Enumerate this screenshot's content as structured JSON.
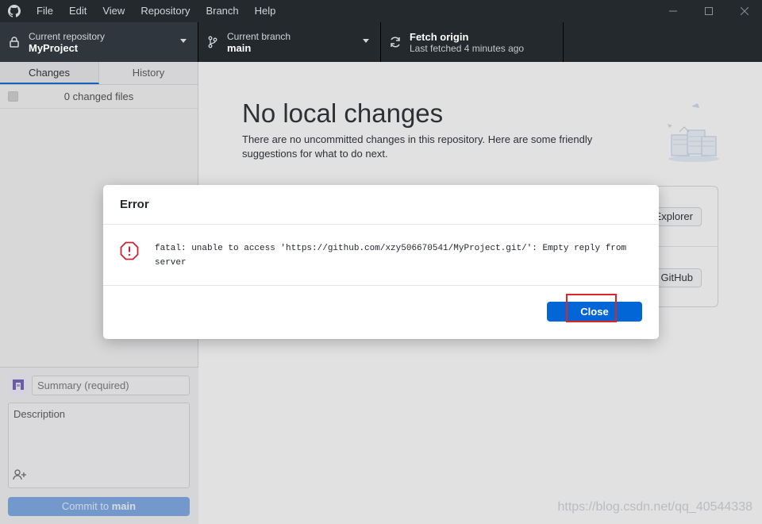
{
  "menu": [
    "File",
    "Edit",
    "View",
    "Repository",
    "Branch",
    "Help"
  ],
  "toolbar": {
    "repo_label": "Current repository",
    "repo_value": "MyProject",
    "branch_label": "Current branch",
    "branch_value": "main",
    "fetch_title": "Fetch origin",
    "fetch_sub": "Last fetched 4 minutes ago"
  },
  "sidebar": {
    "tabs": [
      "Changes",
      "History"
    ],
    "changed_files": "0 changed files",
    "summary_placeholder": "Summary (required)",
    "description_placeholder": "Description",
    "commit_prefix": "Commit to ",
    "commit_branch": "main"
  },
  "main": {
    "title": "No local changes",
    "description": "There are no uncommitted changes in this repository. Here are some friendly suggestions for what to do next.",
    "suggest_button_1": "Explorer",
    "suggest_button_2": "GitHub"
  },
  "dialog": {
    "title": "Error",
    "message": "fatal: unable to access 'https://github.com/xzy506670541/MyProject.git/': Empty reply from server",
    "close_label": "Close"
  },
  "watermark": "https://blog.csdn.net/qq_40544338",
  "colors": {
    "accent": "#0366d6",
    "titlebar": "#24292e",
    "error": "#cb2431",
    "highlight": "#e02424"
  }
}
